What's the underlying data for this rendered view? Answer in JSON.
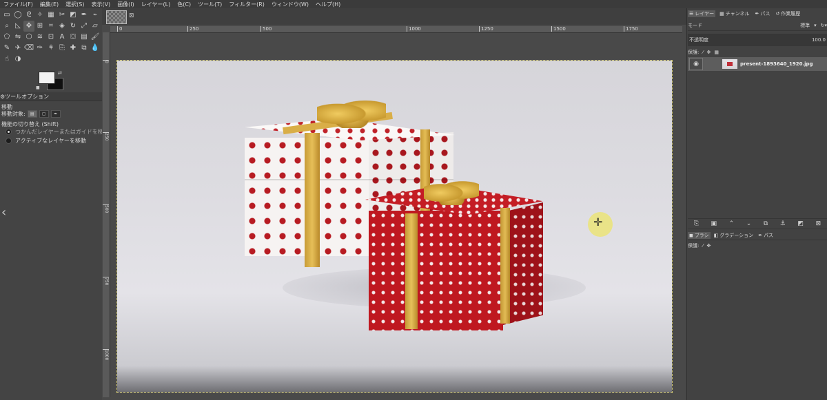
{
  "menubar": [
    "ファイル(F)",
    "編集(E)",
    "選択(S)",
    "表示(V)",
    "画像(I)",
    "レイヤー(L)",
    "色(C)",
    "ツール(T)",
    "フィルター(R)",
    "ウィンドウ(W)",
    "ヘルプ(H)"
  ],
  "tools": [
    {
      "icon": "rect-select-icon",
      "glyph": "▭"
    },
    {
      "icon": "ellipse-select-icon",
      "glyph": "◯"
    },
    {
      "icon": "free-select-icon",
      "glyph": "ᘓ"
    },
    {
      "icon": "fuzzy-select-icon",
      "glyph": "✧"
    },
    {
      "icon": "by-color-select-icon",
      "glyph": "▦"
    },
    {
      "icon": "scissors-icon",
      "glyph": "✂"
    },
    {
      "icon": "foreground-select-icon",
      "glyph": "◩"
    },
    {
      "icon": "paths-icon",
      "glyph": "✒"
    },
    {
      "icon": "color-picker-icon",
      "glyph": "⌁"
    },
    {
      "icon": "zoom-icon",
      "glyph": "⌕"
    },
    {
      "icon": "measure-icon",
      "glyph": "◺"
    },
    {
      "icon": "move-icon",
      "glyph": "✥"
    },
    {
      "icon": "align-icon",
      "glyph": "⊞"
    },
    {
      "icon": "crop-icon",
      "glyph": "⌗"
    },
    {
      "icon": "unified-transform-icon",
      "glyph": "◈"
    },
    {
      "icon": "rotate-icon",
      "glyph": "↻"
    },
    {
      "icon": "scale-icon",
      "glyph": "⤢"
    },
    {
      "icon": "shear-icon",
      "glyph": "▱"
    },
    {
      "icon": "perspective-icon",
      "glyph": "⬠"
    },
    {
      "icon": "flip-icon",
      "glyph": "⇋"
    },
    {
      "icon": "cage-icon",
      "glyph": "⬡"
    },
    {
      "icon": "warp-icon",
      "glyph": "≋"
    },
    {
      "icon": "handle-transform-icon",
      "glyph": "⊡"
    },
    {
      "icon": "text-icon",
      "glyph": "A"
    },
    {
      "icon": "bucket-fill-icon",
      "glyph": "⛋"
    },
    {
      "icon": "gradient-icon",
      "glyph": "▤"
    },
    {
      "icon": "paintbrush-icon",
      "glyph": "🖌"
    },
    {
      "icon": "pencil-icon",
      "glyph": "✎"
    },
    {
      "icon": "airbrush-icon",
      "glyph": "✈"
    },
    {
      "icon": "eraser-icon",
      "glyph": "⌫"
    },
    {
      "icon": "ink-icon",
      "glyph": "✑"
    },
    {
      "icon": "mypaint-brush-icon",
      "glyph": "⚘"
    },
    {
      "icon": "clone-icon",
      "glyph": "⎘"
    },
    {
      "icon": "heal-icon",
      "glyph": "✚"
    },
    {
      "icon": "perspective-clone-icon",
      "glyph": "⧉"
    },
    {
      "icon": "blur-icon",
      "glyph": "💧"
    },
    {
      "icon": "smudge-icon",
      "glyph": "☝"
    },
    {
      "icon": "dodge-burn-icon",
      "glyph": "◑"
    }
  ],
  "tool_options": {
    "tab_label": "ツールオプション",
    "title": "移動",
    "target_label": "移動対象:",
    "toggle_label": "機能の切り替え (Shift)",
    "radio1": "つかんだレイヤーまたはガイドを移動",
    "radio2": "アクティブなレイヤーを移動"
  },
  "ruler": {
    "h_ticks": [
      "0",
      "250",
      "500",
      "1000",
      "1250",
      "1500",
      "1750"
    ],
    "v_ticks": [
      "0",
      "250",
      "500",
      "750",
      "1000"
    ]
  },
  "right_panel": {
    "tabs": [
      "レイヤー",
      "チャンネル",
      "パス",
      "作業履歴"
    ],
    "mode_label": "モード",
    "mode_value": "標準",
    "opacity_label": "不透明度",
    "opacity_value": "100.0",
    "lock_label": "保護:",
    "layer_name": "present-1893640_1920.jpg",
    "brush_tabs": [
      "ブラシ",
      "グラデーション",
      "パス"
    ],
    "lock_label2": "保護:"
  }
}
